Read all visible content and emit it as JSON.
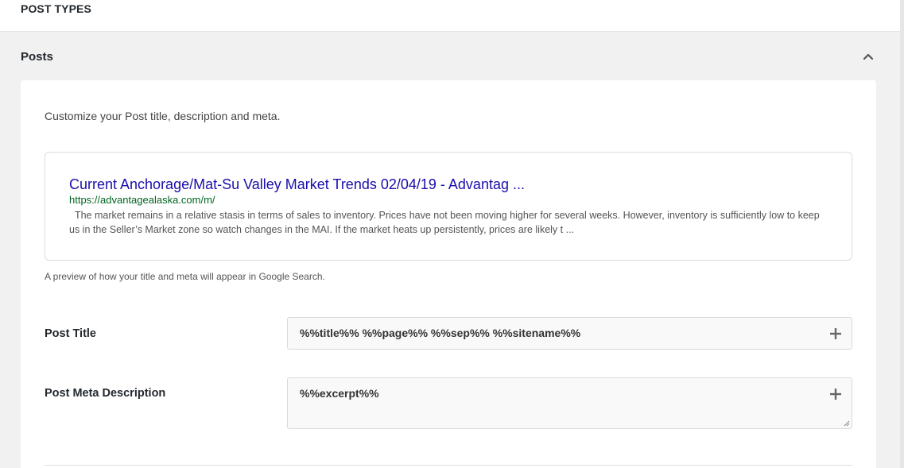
{
  "header": {
    "title": "POST TYPES"
  },
  "section": {
    "label": "Posts",
    "toggle_icon": "chevron-up-icon"
  },
  "card": {
    "intro": "Customize your Post title, description and meta.",
    "preview": {
      "title": "Current Anchorage/Mat-Su Valley Market Trends 02/04/19 - Advantag ...",
      "url": "https://advantagealaska.com/m/",
      "description": "The market remains in a relative stasis in terms of sales to inventory. Prices have not been moving higher for several weeks. However, inventory is sufficiently low to keep us in the Seller’s Market zone so watch changes in the MAI. If the market heats up persistently, prices are likely t ...",
      "note": "A preview of how your title and meta will appear in Google Search."
    },
    "fields": {
      "post_title": {
        "label": "Post Title",
        "value": "%%title%% %%page%% %%sep%% %%sitename%%"
      },
      "post_meta": {
        "label": "Post Meta Description",
        "value": "%%excerpt%%"
      }
    }
  },
  "colors": {
    "preview_title": "#1a0dab",
    "preview_url": "#006621",
    "preview_desc": "#545454"
  }
}
